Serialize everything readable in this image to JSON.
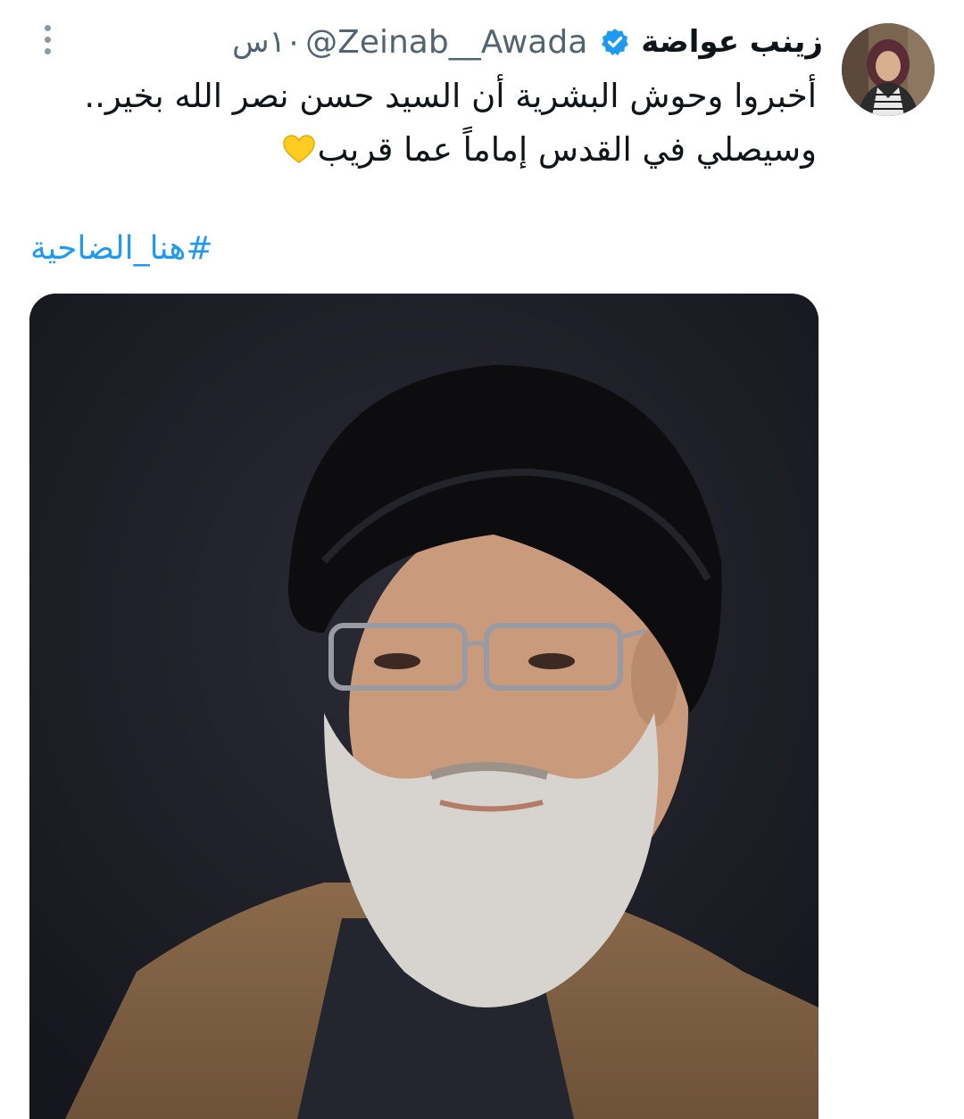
{
  "tweet": {
    "display_name": "زينب عواضة",
    "handle": "@Zeinab__Awada",
    "time": "١٠س",
    "body_lines": [
      "أخبروا وحوش البشرية أن السيد حسن نصر الله بخير..",
      "وسيصلي في القدس إماماً عما قريب"
    ],
    "hashtag": "#هنا_الضاحية",
    "icons": {
      "verified": "verified-badge-icon",
      "more": "more-options-icon",
      "heart": "yellow-heart-emoji"
    },
    "colors": {
      "text": "#0f1419",
      "secondary": "#536471",
      "link": "#1d9bf0",
      "verified": "#1d9bf0",
      "heart": "#ffcc22"
    }
  }
}
